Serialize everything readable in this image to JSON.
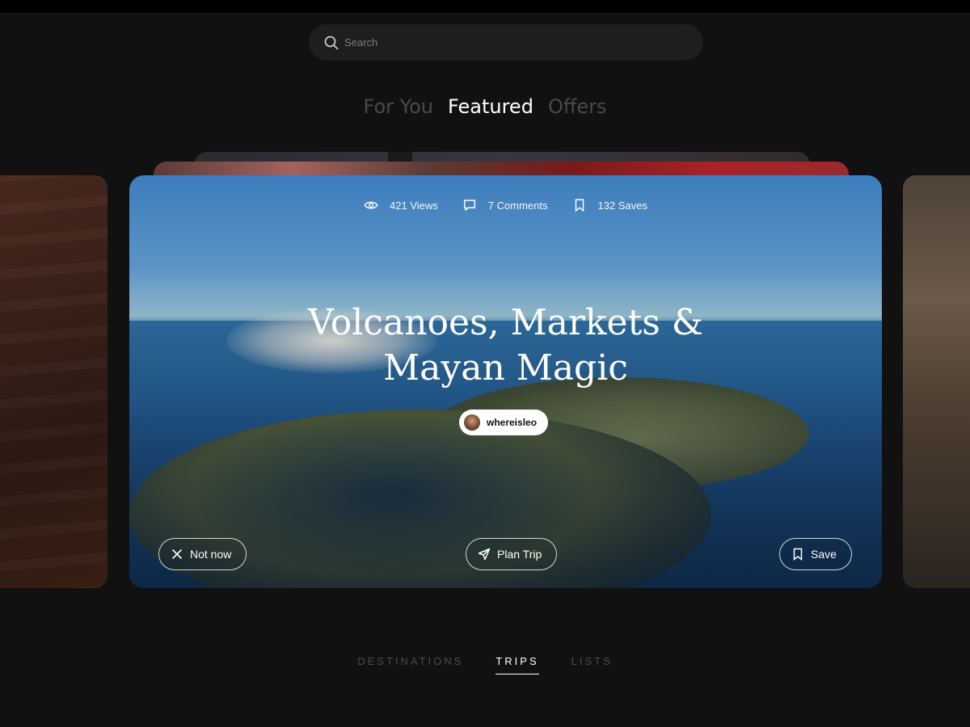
{
  "search": {
    "placeholder": "Search"
  },
  "tabs": [
    {
      "label": "For You",
      "active": false
    },
    {
      "label": "Featured",
      "active": true
    },
    {
      "label": "Offers",
      "active": false
    }
  ],
  "card": {
    "stats": {
      "views": "421 Views",
      "comments": "7 Comments",
      "saves": "132 Saves"
    },
    "title_line1": "Volcanoes, Markets &",
    "title_line2": "Mayan Magic",
    "author": "whereisleo",
    "buttons": {
      "not_now": "Not now",
      "plan_trip": "Plan Trip",
      "save": "Save"
    }
  },
  "bottom_tabs": [
    {
      "label": "DESTINATIONS",
      "active": false
    },
    {
      "label": "TRIPS",
      "active": true
    },
    {
      "label": "LISTS",
      "active": false
    }
  ],
  "colors": {
    "background": "#111111",
    "accent": "#ffffff",
    "muted": "#4a4a4d"
  },
  "icons": [
    "search-icon",
    "eye-icon",
    "comment-icon",
    "bookmark-icon",
    "close-icon",
    "send-icon"
  ]
}
